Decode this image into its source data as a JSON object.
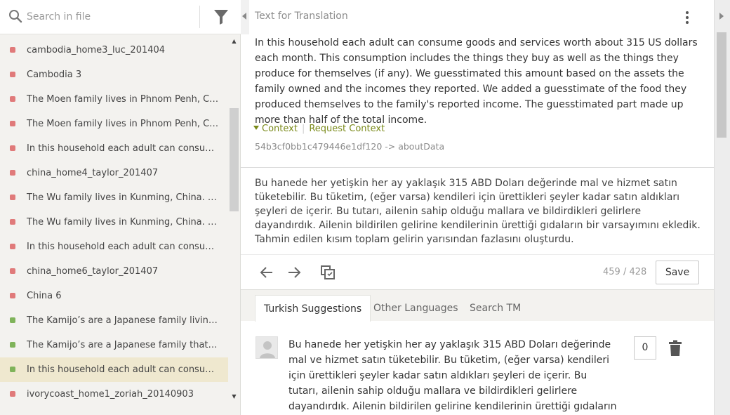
{
  "search": {
    "placeholder": "Search in file"
  },
  "icons": {
    "search": "search-icon",
    "filter": "funnel-icon",
    "kebab": "more-vertical-icon",
    "prev": "arrow-left-icon",
    "next": "arrow-right-icon",
    "copy": "copy-source-icon",
    "delete": "trash-icon",
    "avatar": "user-icon"
  },
  "colors": {
    "status_red": "#e07a7a",
    "status_green": "#7fb35a",
    "accent": "#7a8a1a",
    "selected_row": "#efe8cf"
  },
  "files": [
    {
      "label": "cambodia_home3_luc_201404",
      "status": "red"
    },
    {
      "label": "Cambodia 3",
      "status": "red"
    },
    {
      "label": "The Moen family lives in Phnom Penh, Cam...",
      "status": "red"
    },
    {
      "label": "The Moen family lives in Phnom Penh, Cam...",
      "status": "red"
    },
    {
      "label": "In this household each adult can consume ...",
      "status": "red"
    },
    {
      "label": "china_home4_taylor_201407",
      "status": "red"
    },
    {
      "label": "The Wu family lives in Kunming, China. Wul...",
      "status": "red"
    },
    {
      "label": "The Wu family lives in Kunming, China. Wul...",
      "status": "red"
    },
    {
      "label": "In this household each adult can consume ...",
      "status": "red"
    },
    {
      "label": "china_home6_taylor_201407",
      "status": "red"
    },
    {
      "label": "China 6",
      "status": "red"
    },
    {
      "label": "The Kamijo’s are a Japanese family living in ...",
      "status": "green"
    },
    {
      "label": "The Kamijo’s are a Japanese family that six ...",
      "status": "green"
    },
    {
      "label": "In this household each adult can consume ...",
      "status": "green",
      "selected": true
    },
    {
      "label": "ivorycoast_home1_zoriah_20140903",
      "status": "red"
    }
  ],
  "header": {
    "title": "Text for Translation"
  },
  "source": {
    "text": "In this household each adult can consume goods and services worth about 315 US dollars each month. This consumption includes the things they buy as well as the things they produce for themselves (if any). We guesstimated this amount based on the assets the family owned and the incomes they reported. We added a guesstimate of the food they produced themselves to the family's reported income. The guesstimated part made up more than half of the total income.",
    "context_label": "Context",
    "request_context_label": "Request Context",
    "context_key": "54b3cf0bb1c479446e1df120 -> aboutData"
  },
  "translation": {
    "text": "Bu hanede her yetişkin her ay yaklaşık 315 ABD Doları değerinde mal ve hizmet satın tüketebilir. Bu tüketim, (eğer varsa) kendileri için ürettikleri şeyler kadar satın aldıkları şeyleri de içerir. Bu tutarı, ailenin sahip olduğu mallara ve bildirdikleri gelirlere dayandırdık. Ailenin bildirilen gelirine kendilerinin ürettiği gıdaların bir varsayımını ekledik. Tahmin edilen kısım toplam gelirin yarısından fazlasını oluşturdu."
  },
  "toolbar": {
    "char_count": "459 / 428",
    "save_label": "Save"
  },
  "tabs": [
    {
      "label": "Turkish Suggestions",
      "active": true
    },
    {
      "label": "Other Languages"
    },
    {
      "label": "Search TM"
    }
  ],
  "suggestion": {
    "text": "Bu hanede her yetişkin her ay yaklaşık 315 ABD Doları değerinde mal ve hizmet satın tüketebilir. Bu tüketim, (eğer varsa) kendileri için ürettikleri şeyler kadar satın aldıkları şeyleri de içerir. Bu tutarı, ailenin sahip olduğu mallara ve bildirdikleri gelirlere dayandırdık. Ailenin bildirilen gelirine kendilerinin ürettiği gıdaların bir varsayımını ekledik.",
    "votes": "0"
  }
}
